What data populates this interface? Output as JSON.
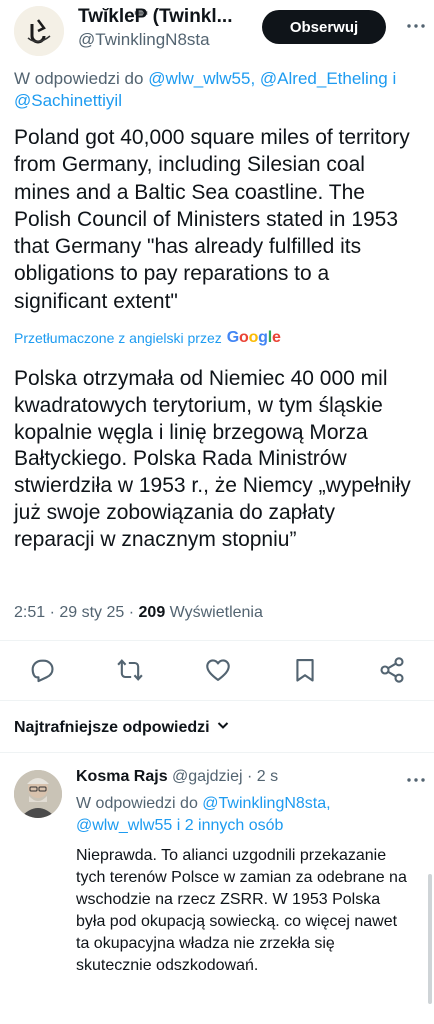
{
  "tweet": {
    "author_name": "Twĭkle₱ (Twinkl...",
    "author_handle": "@TwinklingN8sta",
    "follow_label": "Obserwuj",
    "reply_prefix": "W odpowiedzi do ",
    "reply_to": "@wlw_wlw55, @Alred_Etheling i @Sachinettiyil",
    "text": "Poland got 40,000 square miles of territory from Germany, including Silesian coal mines and a Baltic Sea coastline. The Polish Council of Ministers stated in 1953 that Germany \"has already fulfilled its obligations to pay reparations to a significant extent\"",
    "translated_label": "Przetłumaczone z angielski przez",
    "translator": "Google",
    "translation": "Polska otrzymała od Niemiec 40 000 mil kwadratowych terytorium, w tym śląskie kopalnie węgla i linię brzegową Morza Bałtyckiego. Polska Rada Ministrów stwierdziła w 1953 r., że Niemcy „wypełniły już swoje zobowiązania do zapłaty reparacji w znacznym stopniu”",
    "time": "2:51 · 29 sty 25 · ",
    "views_count": "209",
    "views_label": " Wyświetlenia"
  },
  "actions": {
    "reply_icon": "reply-icon",
    "retweet_icon": "retweet-icon",
    "like_icon": "heart-icon",
    "bookmark_icon": "bookmark-icon",
    "share_icon": "share-icon"
  },
  "replies_header": {
    "label": "Najtrafniejsze odpowiedzi"
  },
  "reply": {
    "name": "Kosma Rajs",
    "handle_time": " @gajdziej · 2 s",
    "reply_prefix": "W odpowiedzi do ",
    "reply_to": "@TwinklingN8sta, @wlw_wlw55 i 2 innych osób",
    "text": "Nieprawda. To alianci uzgodnili przekazanie tych terenów Polsce w zamian za odebrane na wschodzie na rzecz ZSRR. W 1953 Polska była pod okupacją sowiecką. co więcej nawet ta okupacyjna władza nie zrzekła się skutecznie odszkodowań."
  },
  "colors": {
    "link": "#1d9bf0",
    "muted": "#536471",
    "text": "#0f1419",
    "divider": "#eff3f4"
  }
}
